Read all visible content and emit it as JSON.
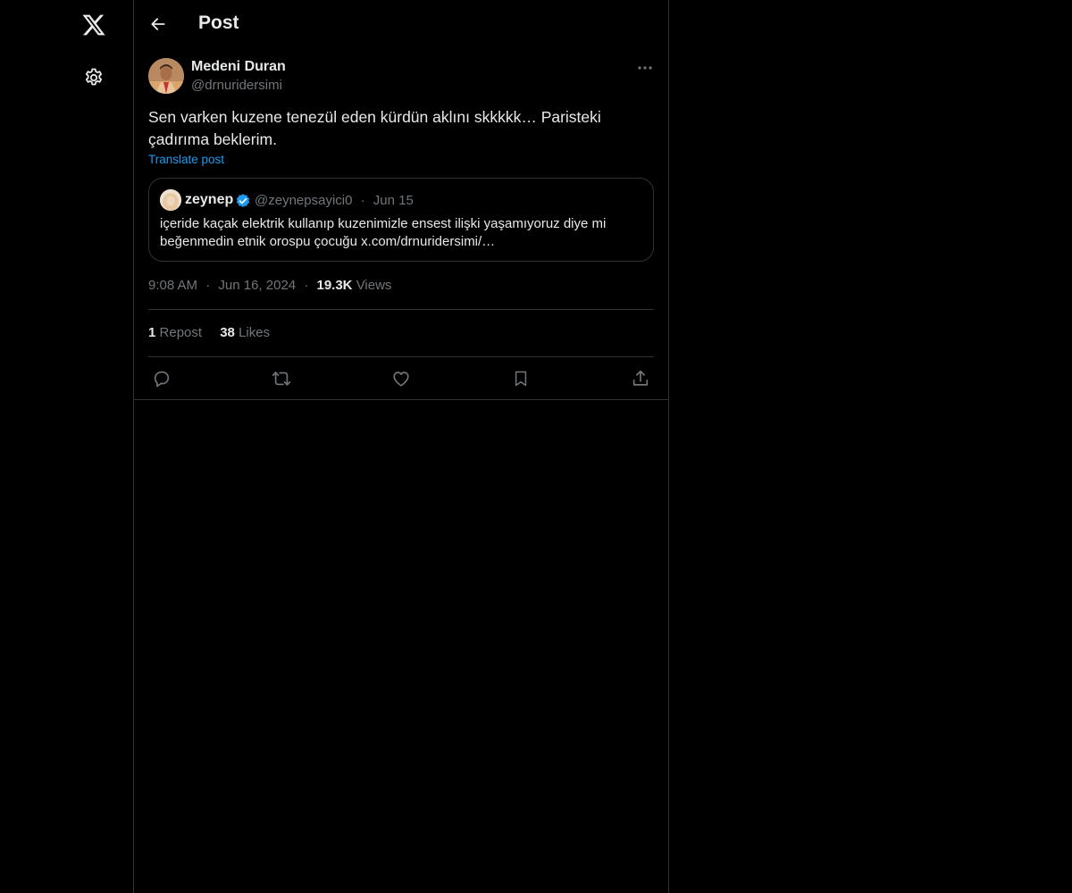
{
  "sidebar": {
    "logo_icon": "x-logo-icon",
    "settings_icon": "gear-icon"
  },
  "header": {
    "title": "Post",
    "back_icon": "arrow-left-icon"
  },
  "post": {
    "author_name": "Medeni Duran",
    "author_handle": "@drnuridersimi",
    "text": "Sen varken kuzene tenezül eden kürdün aklını skkkkk… Paristeki çadırıma beklerim.",
    "translate_label": "Translate post",
    "time": "9:08 AM",
    "date": "Jun 16, 2024",
    "views_count": "19.3K",
    "views_label": "Views",
    "reposts_count": "1",
    "reposts_label": "Repost",
    "likes_count": "38",
    "likes_label": "Likes"
  },
  "quote": {
    "name": "zeynep",
    "handle": "@zeynepsayici0",
    "date": "Jun 15",
    "text": "içeride kaçak elektrik kullanıp kuzenimizle ensest ilişki yaşamıyoruz diye mi beğenmedin etnik orospu çocuğu x.com/drnuridersimi/…"
  },
  "separator": "·",
  "colors": {
    "background": "#000000",
    "text": "#e7e9ea",
    "secondary_text": "#71767b",
    "accent": "#1d9bf0",
    "border": "#2f3336"
  }
}
